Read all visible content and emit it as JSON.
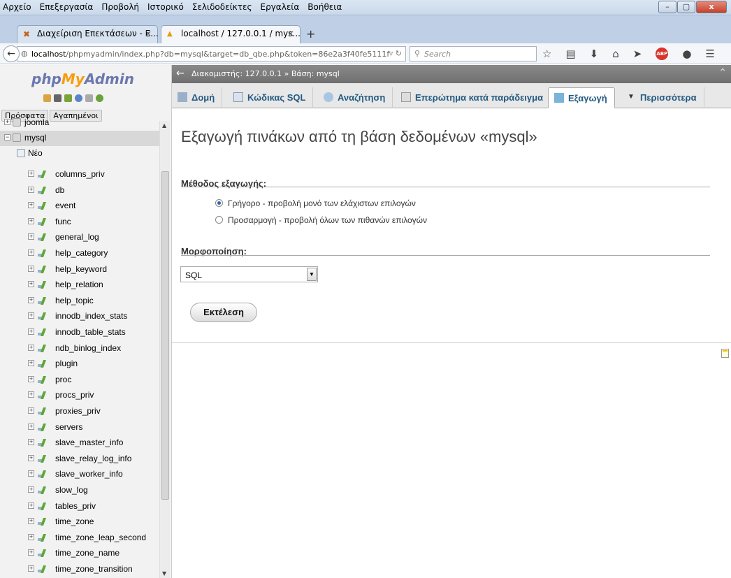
{
  "browser": {
    "menu": [
      "Αρχείο",
      "Επεξεργασία",
      "Προβολή",
      "Ιστορικό",
      "Σελιδοδείκτες",
      "Εργαλεία",
      "Βοήθεια"
    ],
    "tabs": [
      {
        "label": "Διαχείριση Επεκτάσεων - Ε...",
        "active": false
      },
      {
        "label": "localhost / 127.0.0.1 / mys...",
        "active": true
      }
    ],
    "url_host": "localhost",
    "url_rest": "/phpmyadmin/index.php?db=mysql&target=db_qbe.php&token=86e2a3f40fe5111f",
    "search_placeholder": "Search",
    "window_buttons": [
      "–",
      "▢",
      "x"
    ]
  },
  "sidebar": {
    "logo_php": "php",
    "logo_my": "My",
    "logo_admin": "Admin",
    "recent_label": "Πρόσφατα",
    "favorites_label": "Αγαπημένοι",
    "databases": [
      {
        "name": "joomla"
      },
      {
        "name": "mysql",
        "selected": true
      }
    ],
    "new_label": "Νέο",
    "tables": [
      "columns_priv",
      "db",
      "event",
      "func",
      "general_log",
      "help_category",
      "help_keyword",
      "help_relation",
      "help_topic",
      "innodb_index_stats",
      "innodb_table_stats",
      "ndb_binlog_index",
      "plugin",
      "proc",
      "procs_priv",
      "proxies_priv",
      "servers",
      "slave_master_info",
      "slave_relay_log_info",
      "slave_worker_info",
      "slow_log",
      "tables_priv",
      "time_zone",
      "time_zone_leap_second",
      "time_zone_name",
      "time_zone_transition"
    ]
  },
  "breadcrumb": {
    "server": "Διακομιστής: 127.0.0.1",
    "separator": "»",
    "database": "Βάση: mysql"
  },
  "tabs": [
    {
      "label": "Δομή",
      "icon": "structure-icon",
      "active": false
    },
    {
      "label": "Κώδικας SQL",
      "icon": "sql-icon",
      "active": false
    },
    {
      "label": "Αναζήτηση",
      "icon": "search-icon",
      "active": false
    },
    {
      "label": "Επερώτημα κατά παράδειγμα",
      "icon": "query-icon",
      "active": false
    },
    {
      "label": "Εξαγωγή",
      "icon": "export-icon",
      "active": true
    },
    {
      "label": "Περισσότερα",
      "icon": "more-icon",
      "active": false
    }
  ],
  "main": {
    "title": "Εξαγωγή πινάκων από τη βάση δεδομένων «mysql»",
    "method_heading": "Μέθοδος εξαγωγής:",
    "method_options": [
      {
        "label": "Γρήγορο - προβολή μονό των ελάχιστων επιλογών",
        "checked": true
      },
      {
        "label": "Προσαρμογή - προβολή όλων των πιθανών επιλογών",
        "checked": false
      }
    ],
    "format_heading": "Μορφοποίηση:",
    "format_value": "SQL",
    "go_button": "Εκτέλεση"
  },
  "colors": {
    "logo_blue": "#6c78af",
    "logo_orange": "#f89c0e",
    "tab_text": "#235a81"
  }
}
